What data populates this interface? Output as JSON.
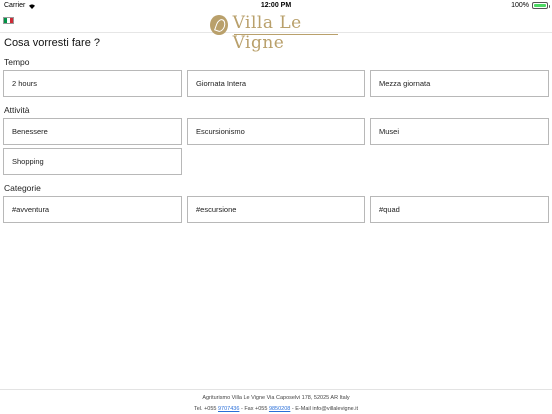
{
  "status_bar": {
    "carrier": "Carrier",
    "time": "12:00 PM",
    "battery": "100%",
    "wifi_icon": "wifi-icon",
    "battery_icon": "battery-icon"
  },
  "header": {
    "flag": "italian-flag-icon",
    "flag_colors": [
      "#009246",
      "#ffffff",
      "#ce2b37"
    ],
    "logo_text": "Villa Le Vigne",
    "brand_color": "#b9a06b"
  },
  "question": "Cosa vorresti fare ?",
  "sections": {
    "tempo": {
      "title": "Tempo",
      "options": [
        "2 hours",
        "Giornata Intera",
        "Mezza giornata"
      ]
    },
    "attivita": {
      "title": "Attività",
      "options": [
        "Benessere",
        "Escursionismo",
        "Musei",
        "Shopping"
      ]
    },
    "categorie": {
      "title": "Categorie",
      "options": [
        "#avventura",
        "#escursione",
        "#quad"
      ]
    }
  },
  "footer": {
    "address": "Agriturismo Villa Le Vigne Via Caposelvi 178, 52025 AR Italy",
    "tel_label": "Tel. +055",
    "tel_number": "9707436",
    "fax_label": "- Fax +055",
    "fax_number": "9850208",
    "email_label": "- E-Mail",
    "email": "info@villalevigne.it",
    "link_color": "#2a6fd8"
  }
}
